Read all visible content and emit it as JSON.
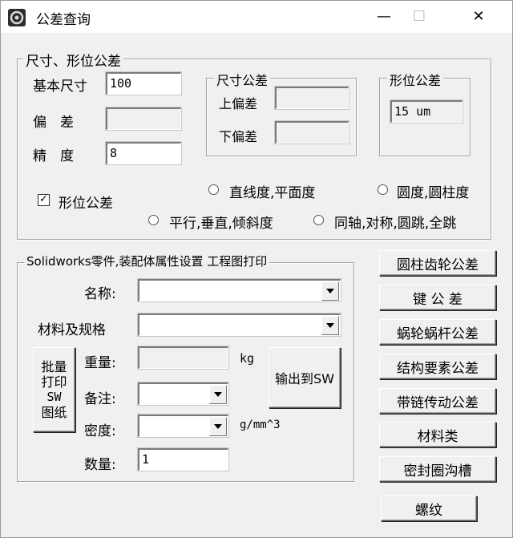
{
  "window": {
    "title": "公差查询",
    "minimize": "—",
    "maximize": "☐",
    "close": "✕"
  },
  "tolerance_group": {
    "title": "尺寸、形位公差",
    "basic_size_label": "基本尺寸",
    "basic_size_value": "100",
    "deviation_label": "偏　差",
    "deviation_value": "",
    "grade_label": "精　度",
    "grade_value": "8",
    "dim_tol": {
      "title": "尺寸公差",
      "upper_label": "上偏差",
      "upper_value": "",
      "lower_label": "下偏差",
      "lower_value": ""
    },
    "form_tol": {
      "title": "形位公差",
      "value": "15 um"
    },
    "form_tol_checkbox_label": "形位公差",
    "form_tol_checkbox_mark": "✓",
    "radios": {
      "straightness": "直线度,平面度",
      "roundness": "圆度,圆柱度",
      "parallelism": "平行,垂直,倾斜度",
      "coaxiality": "同轴,对称,圆跳,全跳"
    }
  },
  "sw_group": {
    "title": "Solidworks零件,装配体属性设置 工程图打印",
    "name_label": "名称:",
    "name_value": "",
    "material_label": "材料及规格",
    "material_value": "",
    "batch_print_button": [
      "批量",
      "打印",
      "SW",
      "图纸"
    ],
    "weight_label": "重量:",
    "weight_value": "",
    "weight_unit": "kg",
    "remark_label": "备注:",
    "remark_value": "",
    "density_label": "密度:",
    "density_value": "",
    "density_unit": "g/mm^3",
    "quantity_label": "数量:",
    "quantity_value": "1",
    "export_button": "输出到SW"
  },
  "side_buttons": {
    "gear": "圆柱齿轮公差",
    "key": "键 公 差",
    "worm": "蜗轮蜗杆公差",
    "structure": "结构要素公差",
    "belt_chain": "带链传动公差",
    "material": "材料类",
    "seal_groove": "密封圈沟槽",
    "thread": "螺纹"
  },
  "icons": {
    "app": "app-logo-icon",
    "dropdown": "chevron-down-icon"
  }
}
